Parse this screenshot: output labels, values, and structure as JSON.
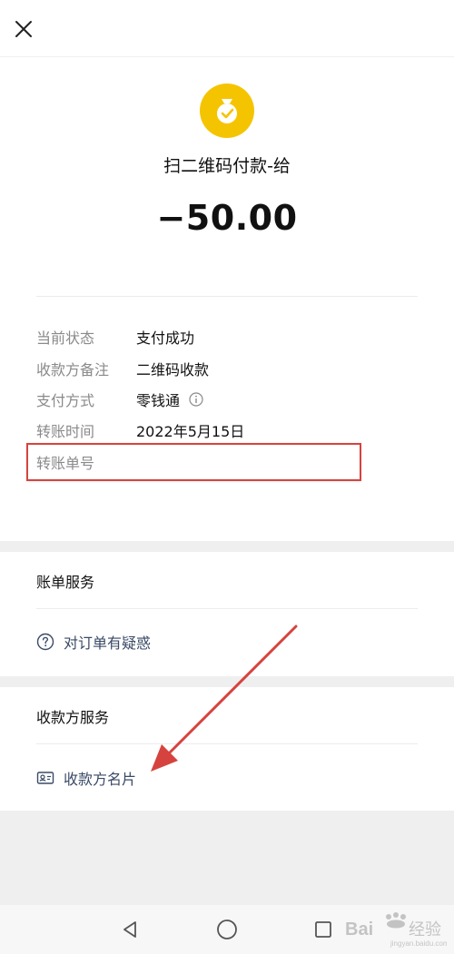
{
  "header": {
    "close_icon": "close-icon"
  },
  "summary": {
    "avatar_icon": "money-bag-check-icon",
    "avatar_color": "#f5c400",
    "title": "扫二维码付款-给",
    "amount": "−50.00"
  },
  "details": [
    {
      "label": "当前状态",
      "value": "支付成功"
    },
    {
      "label": "收款方备注",
      "value": "二维码收款"
    },
    {
      "label": "支付方式",
      "value": "零钱通"
    },
    {
      "label": "转账时间",
      "value": "2022年5月15日"
    },
    {
      "label": "转账单号",
      "value": ""
    }
  ],
  "annotation_color": "#d6433f",
  "bill_service": {
    "title": "账单服务",
    "link_label": "对订单有疑惑",
    "link_icon": "question-circle-icon"
  },
  "payee_service": {
    "title": "收款方服务",
    "link_label": "收款方名片",
    "link_icon": "contact-card-icon"
  },
  "nav": {
    "back_icon": "back-triangle-icon",
    "home_icon": "home-circle-icon",
    "recents_icon": "recents-square-icon"
  },
  "watermark": {
    "text": "Baidu经验",
    "subtext": "jingyan.baidu.com"
  }
}
